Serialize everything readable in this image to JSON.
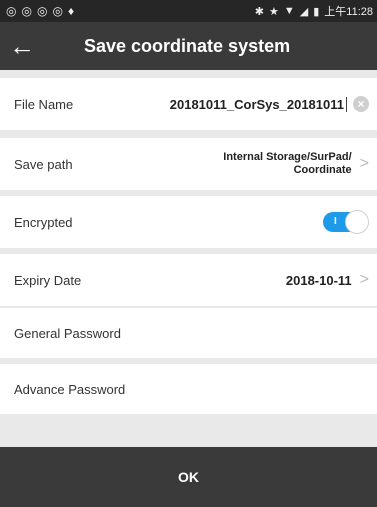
{
  "statusbar": {
    "left_icons": [
      "◎",
      "◎",
      "◎",
      "◎",
      "♦"
    ],
    "right_icons": [
      "✱",
      "★",
      "▼",
      "◢",
      "▮"
    ],
    "time": "上午11:28"
  },
  "header": {
    "back_icon": "←",
    "title": "Save coordinate system"
  },
  "form": {
    "file_name": {
      "label": "File Name",
      "value": "20181011_CorSys_20181011",
      "clear_icon": "×"
    },
    "save_path": {
      "label": "Save path",
      "value_line1": "Internal Storage/SurPad/",
      "value_line2": "Coordinate",
      "chevron": ">"
    },
    "encrypted": {
      "label": "Encrypted",
      "state": "on",
      "mark": "I"
    },
    "expiry_date": {
      "label": "Expiry Date",
      "value": "2018-10-11",
      "chevron": ">"
    },
    "general_password": {
      "label": "General Password",
      "value": ""
    },
    "advance_password": {
      "label": "Advance Password",
      "value": ""
    }
  },
  "footer": {
    "ok_label": "OK"
  },
  "colors": {
    "header_bg": "#3a3a3a",
    "toggle_on": "#1e9be8",
    "page_bg": "#e9e9e9"
  }
}
